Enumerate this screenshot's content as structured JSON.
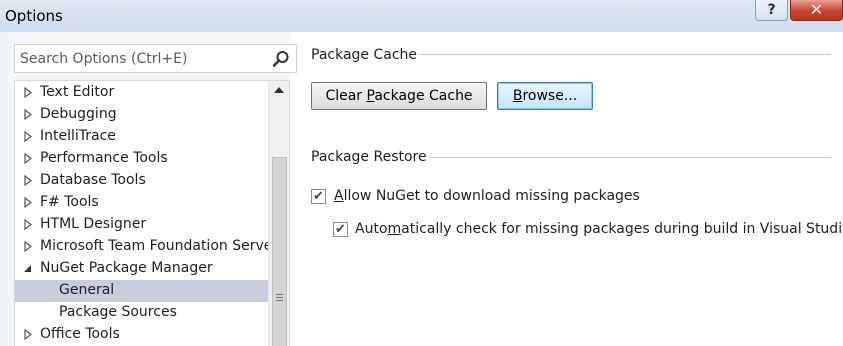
{
  "window": {
    "title": "Options",
    "help_label": "?",
    "close_label": "✕"
  },
  "search": {
    "placeholder": "Search Options (Ctrl+E)"
  },
  "tree": {
    "items": [
      {
        "label": "Text Editor",
        "expanded": false
      },
      {
        "label": "Debugging",
        "expanded": false
      },
      {
        "label": "IntelliTrace",
        "expanded": false
      },
      {
        "label": "Performance Tools",
        "expanded": false
      },
      {
        "label": "Database Tools",
        "expanded": false
      },
      {
        "label": "F# Tools",
        "expanded": false
      },
      {
        "label": "HTML Designer",
        "expanded": false
      },
      {
        "label": "Microsoft Team Foundation Server",
        "expanded": false
      },
      {
        "label": "NuGet Package Manager",
        "expanded": true
      },
      {
        "label": "General",
        "child": true,
        "selected": true
      },
      {
        "label": "Package Sources",
        "child": true
      },
      {
        "label": "Office Tools",
        "expanded": false
      }
    ]
  },
  "package_cache": {
    "header": "Package Cache",
    "clear_button": {
      "before": "Clear ",
      "accel": "P",
      "after": "ackage Cache"
    },
    "browse_button": {
      "accel": "B",
      "after": "rowse..."
    }
  },
  "package_restore": {
    "header": "Package Restore",
    "allow_download": {
      "before": "",
      "accel": "A",
      "after": "llow NuGet to download missing packages",
      "checked": true
    },
    "auto_check": {
      "before": "Auto",
      "accel": "m",
      "after": "atically check for missing packages during build in Visual Studio",
      "checked": true
    }
  },
  "colors": {
    "selected_row": "#c9ccdc",
    "focus_border": "#3c7fb1"
  },
  "icons": {
    "search": "search-icon",
    "collapsed": "triangle-right-icon",
    "expanded": "triangle-down-icon",
    "check": "checkmark-icon"
  }
}
